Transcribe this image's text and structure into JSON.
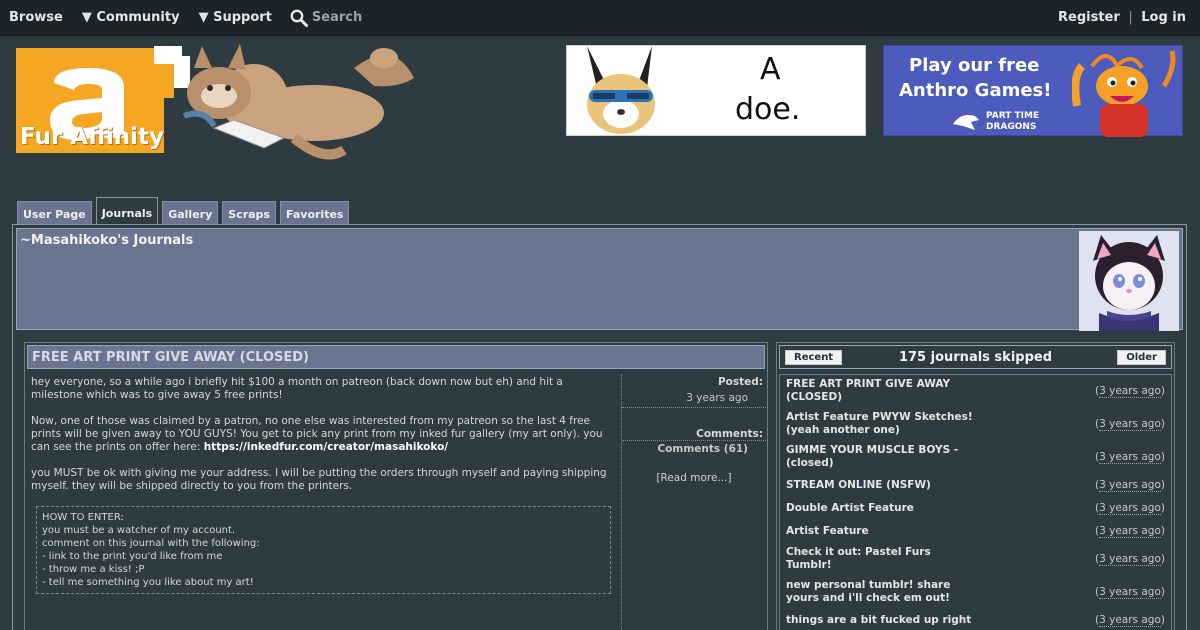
{
  "topnav": {
    "browse": "Browse",
    "community": "▼ Community",
    "support": "▼ Support",
    "search": "Search",
    "register": "Register",
    "separator": "|",
    "login": "Log in"
  },
  "logo": {
    "text": "Fur Affinity"
  },
  "ads": {
    "ad1_line1": "A",
    "ad1_line2": "doe.",
    "ad2_line1": "Play our free",
    "ad2_line2": "Anthro Games!",
    "ad2_brand1": "PART TIME",
    "ad2_brand2": "DRAGONS"
  },
  "tabs": [
    "User Page",
    "Journals",
    "Gallery",
    "Scraps",
    "Favorites"
  ],
  "active_tab": "Journals",
  "user": {
    "title": "~Masahikoko's Journals"
  },
  "journal": {
    "title": "FREE ART PRINT GIVE AWAY (CLOSED)",
    "para1": "hey everyone, so a while ago i briefly hit $100 a month on patreon (back down now but eh) and hit a milestone which was to give away 5 free prints!",
    "para2": "Now, one of those was claimed by a patron, no one else was interested from my patreon so the last 4 free prints will be given away to YOU GUYS! You get to pick any print from my inked fur gallery (my art only). you can see the prints on offer here: ",
    "link": "https://inkedfur.com/creator/masahikoko/",
    "para3": "you MUST be ok with giving me your address. I will be putting the orders through myself and paying shipping myself. they will be shipped directly to you from the printers.",
    "how_lines": [
      "HOW TO ENTER:",
      "you must be a watcher of my account.",
      "comment on this journal with the following:",
      "- link to the print you'd like from me",
      "- throw me a kiss! ;P",
      "- tell me something you like about my art!"
    ],
    "posted_label": "Posted:",
    "posted_value": "3 years ago",
    "comments_label": "Comments:",
    "comments_value": "Comments (61)",
    "read_more": "[Read more...]"
  },
  "sidebar": {
    "recent": "Recent",
    "skipped": "175 journals skipped",
    "older": "Older",
    "items": [
      {
        "title": "FREE ART PRINT GIVE AWAY (CLOSED)",
        "time": "3 years ago"
      },
      {
        "title": "Artist Feature PWYW Sketches! (yeah another one)",
        "time": "3 years ago"
      },
      {
        "title": "GIMME YOUR MUSCLE BOYS - (closed)",
        "time": "3 years ago"
      },
      {
        "title": "STREAM ONLINE (NSFW)",
        "time": "3 years ago"
      },
      {
        "title": "Double Artist Feature",
        "time": "3 years ago"
      },
      {
        "title": "Artist Feature",
        "time": "3 years ago"
      },
      {
        "title": "Check it out: Pastel Furs Tumblr!",
        "time": "3 years ago"
      },
      {
        "title": "new personal tumblr! share yours and i'll check em out!",
        "time": "3 years ago"
      },
      {
        "title": "things are a bit fucked up right",
        "time": "3 years ago"
      }
    ]
  },
  "colors": {
    "background": "#2e3b41",
    "topbar": "#1d2429",
    "panel": "#6c7590",
    "logo_orange": "#f5a623",
    "ad_blue": "#4d5bbd"
  }
}
